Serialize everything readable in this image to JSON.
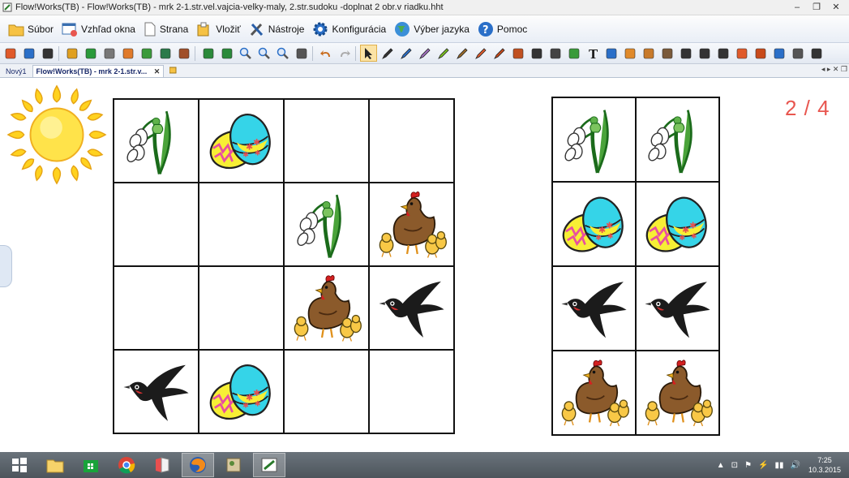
{
  "window": {
    "title": "Flow!Works(TB) - Flow!Works(TB) - mrk 2-1.str.vel.vajcia-velky-maly, 2.str.sudoku -doplnat 2 obr.v riadku.hht",
    "minimize": "–",
    "restore": "❐",
    "close": "✕"
  },
  "menu": {
    "items": [
      {
        "label": "Súbor",
        "icon": "folder-icon"
      },
      {
        "label": "Vzhľad okna",
        "icon": "window-view-icon"
      },
      {
        "label": "Strana",
        "icon": "page-icon"
      },
      {
        "label": "Vložiť",
        "icon": "insert-icon"
      },
      {
        "label": "Nástroje",
        "icon": "tools-icon"
      },
      {
        "label": "Konfigurácia",
        "icon": "gear-icon"
      },
      {
        "label": "Výber jazyka",
        "icon": "globe-icon"
      },
      {
        "label": "Pomoc",
        "icon": "help-icon"
      }
    ]
  },
  "toolbar": {
    "tools": [
      "refresh",
      "fullscreen",
      "window",
      "edit",
      "new-page",
      "delete-page",
      "copy-page",
      "image",
      "image-2",
      "page-out",
      "prev-page",
      "next-page",
      "zoom-in",
      "zoom-out",
      "zoom-fit",
      "pan",
      "undo",
      "redo",
      "select",
      "pen",
      "brush",
      "marker",
      "highlighter",
      "pen-2",
      "crayon",
      "feather",
      "eraser",
      "shape",
      "film",
      "picture",
      "text",
      "shapes-x",
      "ruler",
      "palette",
      "pattern",
      "lines",
      "dashes",
      "lines-2",
      "camera",
      "magic",
      "spotlight",
      "frame",
      "phone"
    ]
  },
  "tabs": {
    "items": [
      {
        "label": "Nový1",
        "active": false
      },
      {
        "label": "Flow!Works(TB) - mrk 2-1.str.v...",
        "active": true
      }
    ],
    "close_label": "✕",
    "nav": "◂ ▸ ✕ ❐"
  },
  "page": {
    "counter": "2 / 4"
  },
  "sudoku": {
    "grid": [
      [
        "snowdrop",
        "egg",
        "",
        ""
      ],
      [
        "",
        "",
        "snowdrop",
        "hen"
      ],
      [
        "",
        "",
        "hen",
        "swallow"
      ],
      [
        "swallow",
        "egg",
        "",
        ""
      ]
    ]
  },
  "palette": {
    "grid": [
      [
        "snowdrop",
        "snowdrop"
      ],
      [
        "egg",
        "egg"
      ],
      [
        "swallow",
        "swallow"
      ],
      [
        "hen",
        "hen"
      ]
    ]
  },
  "taskbar": {
    "apps": [
      "start",
      "file-explorer",
      "store",
      "chrome",
      "ebook-reader",
      "firefox",
      "image-viewer",
      "flowworks"
    ],
    "tray": [
      "▲",
      "⊡",
      "⚑",
      "⚡",
      "▮▮",
      "🔊"
    ],
    "time": "7:25",
    "date": "10.3.2015"
  },
  "colors": {
    "accent_red": "#e8564f",
    "menu_bg": "#e9eef6",
    "taskbar": "#4d555c"
  }
}
